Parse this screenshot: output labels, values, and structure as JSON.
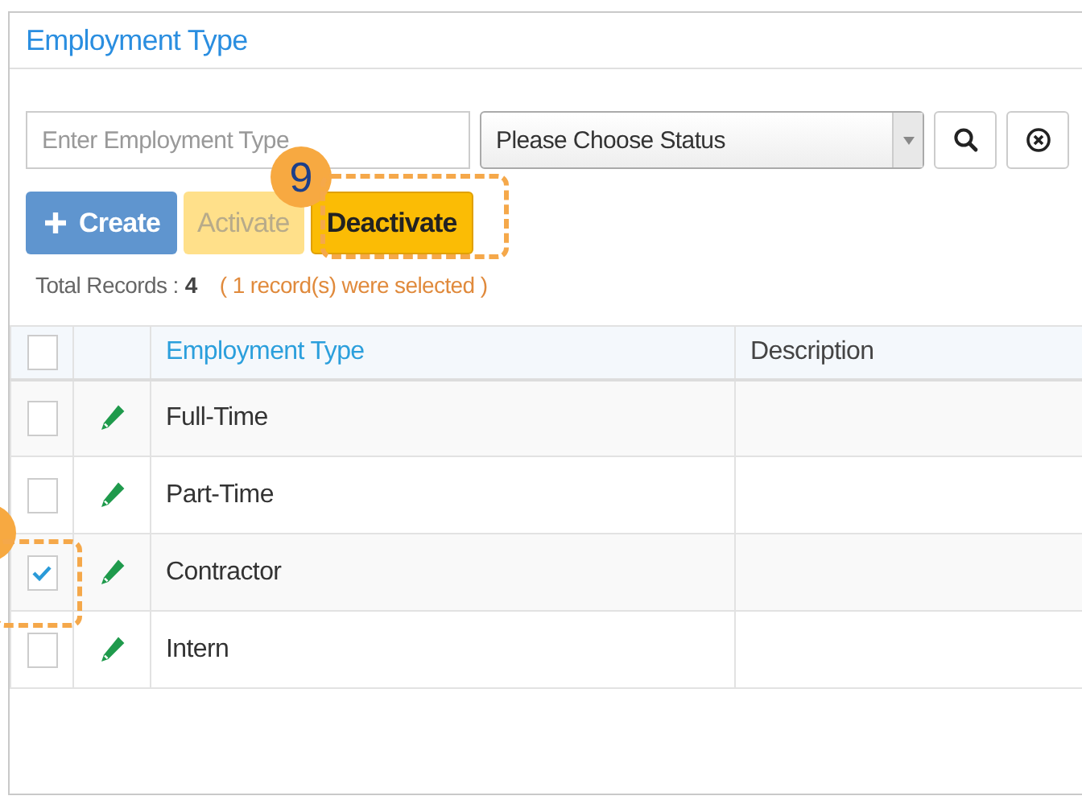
{
  "panel": {
    "title": "Employment Type"
  },
  "filters": {
    "type_field": {
      "placeholder": "Enter Employment Type"
    },
    "status_select": {
      "value": "Please Choose Status"
    }
  },
  "actions": [
    {
      "kind": "create",
      "label": "Create",
      "disabled": false
    },
    {
      "kind": "activate",
      "label": "Activate",
      "disabled": true
    },
    {
      "kind": "deactivate",
      "label": "Deactivate",
      "disabled": false
    }
  ],
  "summary": {
    "label": "Total Records :",
    "count": "4",
    "selection": "( 1 record(s) were selected )"
  },
  "table": {
    "select_all_checked": false,
    "columns": [
      {
        "label": "Employment Type",
        "sorted": true
      },
      {
        "label": "Description",
        "sorted": false
      }
    ],
    "rows": [
      {
        "name": "Full-Time",
        "checked": false
      },
      {
        "name": "Part-Time",
        "checked": false
      },
      {
        "name": "Contractor",
        "checked": true
      },
      {
        "name": "Intern",
        "checked": false
      }
    ]
  },
  "annotations": [
    {
      "kind": "step",
      "label": "9"
    },
    {
      "kind": "step_partial"
    }
  ]
}
